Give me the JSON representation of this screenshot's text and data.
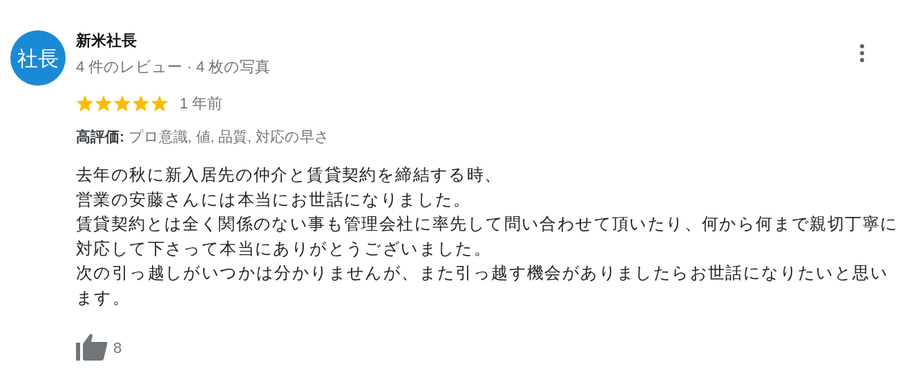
{
  "reviewer": {
    "avatar_text": "社長",
    "name": "新米社長",
    "stats": "4 件のレビュー · 4 枚の写真"
  },
  "rating": {
    "stars": 5,
    "time": "1 年前"
  },
  "highlights": "**高評価:** プロ意識, 値, 品質, 対応の早さ",
  "review_lines": [
    "去年の秋に新入居先の仲介と賃貸契約を締結する時、",
    "営業の安藤さんには本当にお世話になりました。",
    "賃貸契約とは全く関係のない事も管理会社に率先して問い合わせて頂いたり、何から何まで親切丁寧に",
    "対応して下さって本当にありがとうございました。",
    "次の引っ越しがいつかは分かりませんが、また引っ越す機会がありましたらお世話になりたいと思います。"
  ],
  "likes": {
    "count": "8"
  }
}
